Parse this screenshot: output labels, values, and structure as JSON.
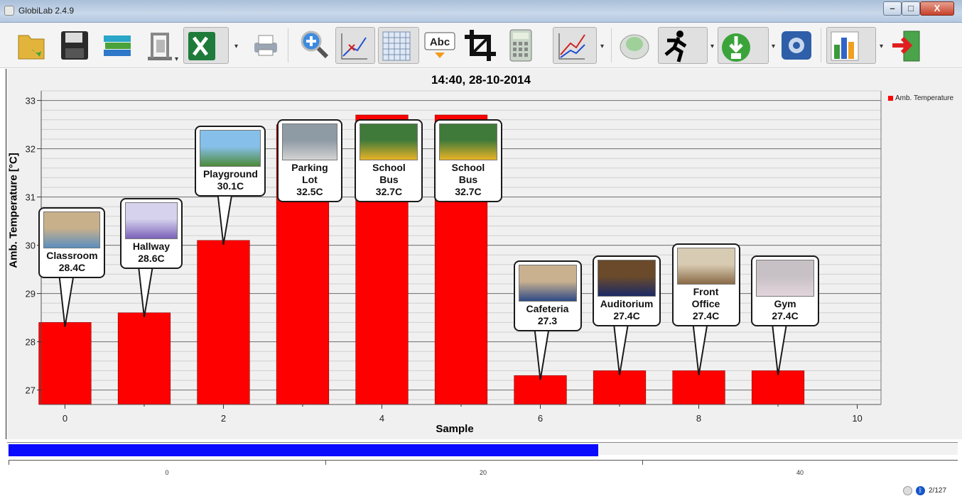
{
  "window": {
    "title": "GlobiLab 2.4.9"
  },
  "toolbar": {
    "buttons": [
      "open-folder-icon",
      "save-icon",
      "books-icon",
      "lab-stand-icon",
      "excel-icon",
      "printer-icon",
      "zoom-in-icon",
      "line-graph-icon",
      "grid-icon",
      "text-label-icon",
      "crop-icon",
      "calculator-icon",
      "line-chart-options-icon",
      "logger-device-icon",
      "run-icon",
      "download-icon",
      "settings-icon",
      "bar-chart-icon",
      "exit-icon"
    ],
    "text_label_glyph": "Abc"
  },
  "chart": {
    "title": "14:40, 28-10-2014",
    "xlabel": "Sample",
    "ylabel": "Amb. Temperature [°C]",
    "legend": "Amb. Temperature"
  },
  "chart_data": {
    "type": "bar",
    "x": [
      0,
      1,
      2,
      3,
      4,
      5,
      6,
      7,
      8,
      9
    ],
    "values": [
      28.4,
      28.6,
      30.1,
      32.5,
      32.7,
      32.7,
      27.3,
      27.4,
      27.4,
      27.4
    ],
    "series": [
      {
        "name": "Amb. Temperature",
        "color": "#ff0000"
      }
    ],
    "xlim": [
      -0.3,
      10.3
    ],
    "ylim": [
      26.7,
      33.2
    ],
    "xticks": [
      0,
      2,
      4,
      6,
      8,
      10
    ],
    "yticks": [
      27,
      28,
      29,
      30,
      31,
      32,
      33
    ],
    "grid": true,
    "legend_position": "top-right",
    "annotations": [
      {
        "label_lines": [
          "Classroom",
          "28.4C"
        ],
        "image": "classroom photo"
      },
      {
        "label_lines": [
          "Hallway",
          "28.6C"
        ],
        "image": "hallway photo"
      },
      {
        "label_lines": [
          "Playground",
          "30.1C"
        ],
        "image": "playground photo"
      },
      {
        "label_lines": [
          "Parking",
          "Lot",
          "32.5C"
        ],
        "image": "parking lot photo"
      },
      {
        "label_lines": [
          "School",
          "Bus",
          "32.7C"
        ],
        "image": "school bus photo"
      },
      {
        "label_lines": [
          "School",
          "Bus",
          "32.7C"
        ],
        "image": "school bus photo"
      },
      {
        "label_lines": [
          "Cafeteria",
          "27.3"
        ],
        "image": "cafeteria photo"
      },
      {
        "label_lines": [
          "Auditorium",
          "27.4C"
        ],
        "image": "auditorium photo"
      },
      {
        "label_lines": [
          "Front",
          "Office",
          "27.4C"
        ],
        "image": "front office photo"
      },
      {
        "label_lines": [
          "Gym",
          "27.4C"
        ],
        "image": "gym photo"
      }
    ]
  },
  "overview": {
    "progress": 0.62,
    "ticks": [
      "0",
      "20",
      "40"
    ]
  },
  "status": {
    "sample_count": "2/127"
  }
}
